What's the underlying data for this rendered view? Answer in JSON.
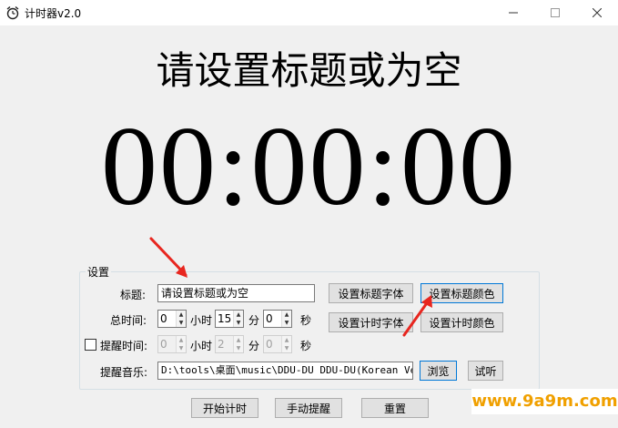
{
  "window": {
    "title": "计时器v2.0"
  },
  "main_title": "请设置标题或为空",
  "timer": {
    "display": "00:00:00"
  },
  "settings": {
    "group_label": "设置",
    "title_label": "标题:",
    "title_value": "请设置标题或为空",
    "total_time_label": "总时间:",
    "total_hours": "0",
    "hours_unit": "小时",
    "total_minutes": "15",
    "minutes_unit": "分",
    "total_seconds": "0",
    "seconds_unit": "秒",
    "reminder_label": "提醒时间:",
    "reminder_hours": "0",
    "reminder_minutes": "2",
    "reminder_seconds": "0",
    "music_label": "提醒音乐:",
    "music_path": "D:\\tools\\桌面\\music\\DDU-DU  DDU-DU(Korean  Ver",
    "set_title_font": "设置标题字体",
    "set_title_color": "设置标题颜色",
    "set_timer_font": "设置计时字体",
    "set_timer_color": "设置计时颜色",
    "browse": "浏览",
    "listen": "试听"
  },
  "actions": {
    "start": "开始计时",
    "manual_remind": "手动提醒",
    "reset": "重置"
  },
  "watermark": "www.9a9m.com",
  "icons": {
    "app": "alarm-clock-icon",
    "annotation": "red-arrow-icon"
  },
  "colors": {
    "annotation_arrow": "#e8261f",
    "focus_border": "#0078d7",
    "watermark": "#f0a000"
  }
}
